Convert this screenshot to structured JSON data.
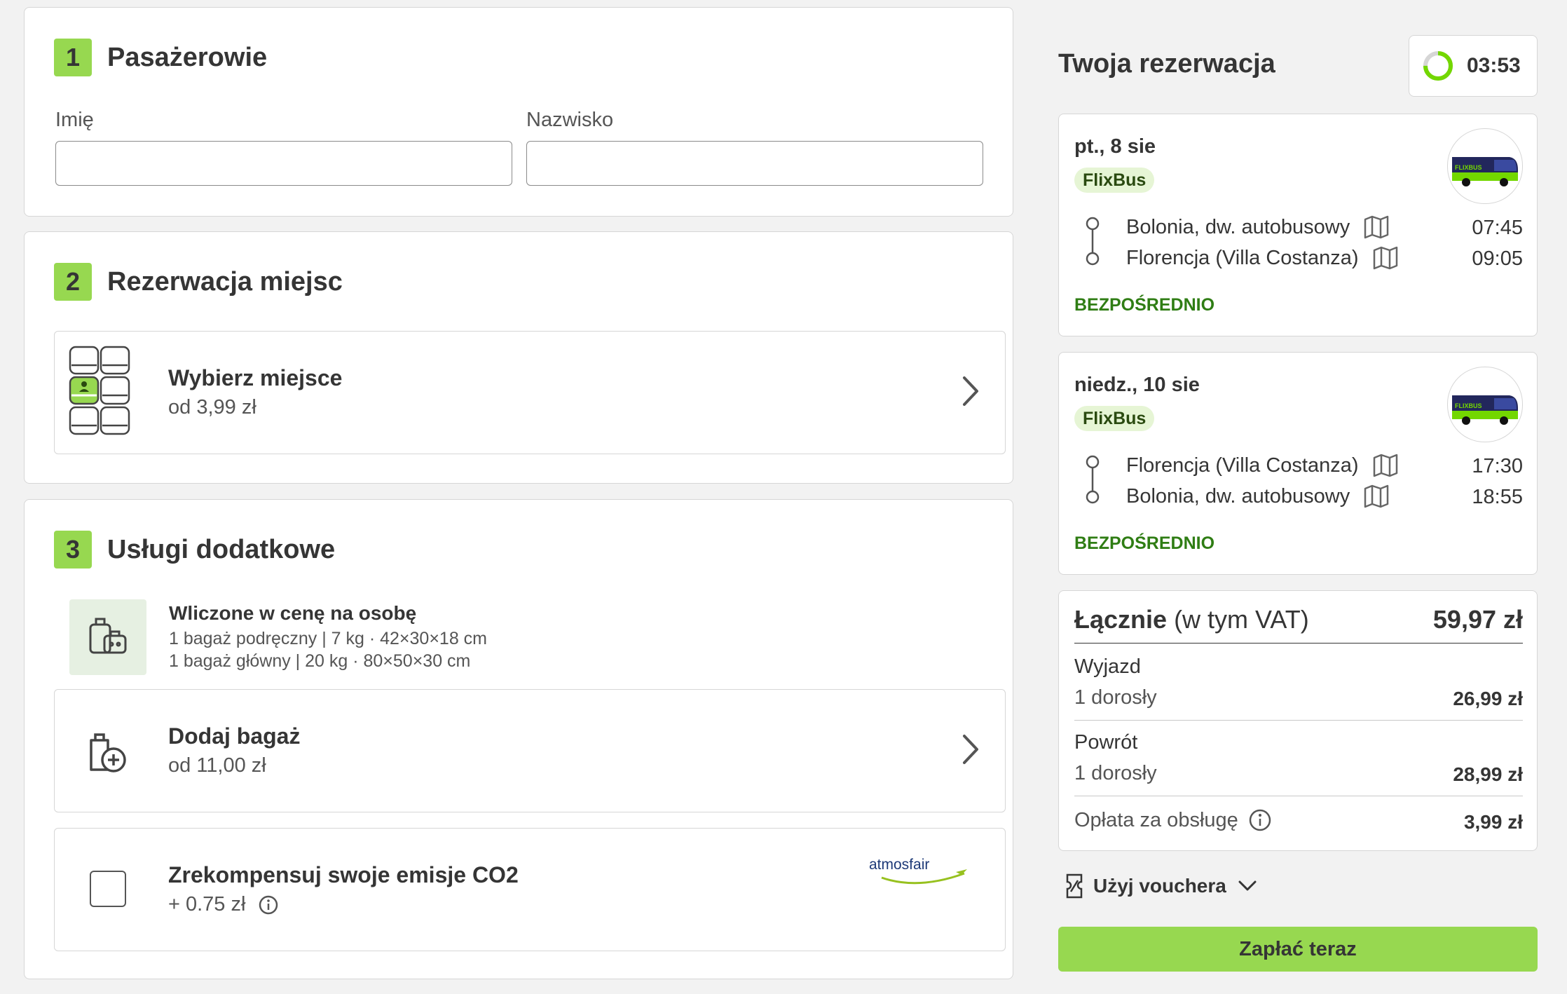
{
  "sections": {
    "passengers": {
      "number": "1",
      "title": "Pasażerowie",
      "first_name_label": "Imię",
      "first_name_value": "",
      "last_name_label": "Nazwisko",
      "last_name_value": ""
    },
    "seats": {
      "number": "2",
      "title": "Rezerwacja miejsc",
      "option_title": "Wybierz miejsce",
      "option_price": "od 3,99 zł"
    },
    "extras": {
      "number": "3",
      "title": "Usługi dodatkowe",
      "included_title": "Wliczone w cenę na osobę",
      "included_line1": "1 bagaż podręczny | 7 kg · 42×30×18 cm",
      "included_line2": "1 bagaż główny | 20 kg · 80×50×30 cm",
      "add_bag_title": "Dodaj bagaż",
      "add_bag_price": "od 11,00 zł",
      "co2_title": "Zrekompensuj swoje emisje CO2",
      "co2_price": "+ 0.75 zł",
      "co2_partner": "atmosfair"
    }
  },
  "summary": {
    "title": "Twoja rezerwacja",
    "timer": "03:53",
    "timer_progress": 0.75,
    "trips": [
      {
        "date": "pt., 8 sie",
        "brand": "FlixBus",
        "from": "Bolonia, dw. autobusowy",
        "from_time": "07:45",
        "to": "Florencja (Villa Costanza)",
        "to_time": "09:05",
        "type": "BEZPOŚREDNIO"
      },
      {
        "date": "niedz., 10 sie",
        "brand": "FlixBus",
        "from": "Florencja (Villa Costanza)",
        "from_time": "17:30",
        "to": "Bolonia, dw. autobusowy",
        "to_time": "18:55",
        "type": "BEZPOŚREDNIO"
      }
    ],
    "total_label": "Łącznie",
    "total_vat": "(w tym VAT)",
    "total_value": "59,97 zł",
    "outbound_label": "Wyjazd",
    "outbound_pax": "1 dorosły",
    "outbound_price": "26,99 zł",
    "return_label": "Powrót",
    "return_pax": "1 dorosły",
    "return_price": "28,99 zł",
    "fee_label": "Opłata za obsługę",
    "fee_price": "3,99 zł",
    "voucher_label": "Użyj vouchera",
    "pay_label": "Zapłać teraz"
  },
  "colors": {
    "accent": "#97d850",
    "direct": "#2f7d14",
    "badge_bg": "#e6f5d5",
    "timer_ring": "#73d700"
  },
  "bus_logo_text": "FLIXBUS",
  "icons": [
    "seat-map-icon",
    "chevron-right-icon",
    "luggage-icon",
    "add-luggage-icon",
    "checkbox",
    "info-icon",
    "map-icon",
    "route-icon",
    "bus-icon",
    "voucher-icon",
    "chevron-down-icon",
    "timer-ring-icon"
  ]
}
